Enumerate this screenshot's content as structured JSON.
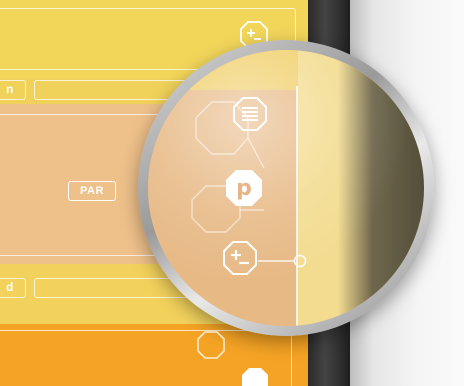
{
  "tiles": {
    "par_label": "PAR",
    "slot_letter_upper": "n",
    "slot_letter_lower": "d"
  },
  "icons": {
    "top_right": "plus-minus-icon",
    "stack": "stack-icon",
    "parameter": "parameter-p-icon",
    "plus_minus": "plus-minus-icon",
    "connector": "connector-node-icon",
    "parameter_glyph": "p"
  },
  "colors": {
    "yellow": "#f2d65a",
    "peach": "#eec08a",
    "orange": "#f4a324",
    "outline": "#ffffff",
    "window_dark": "#2a2a2a"
  }
}
